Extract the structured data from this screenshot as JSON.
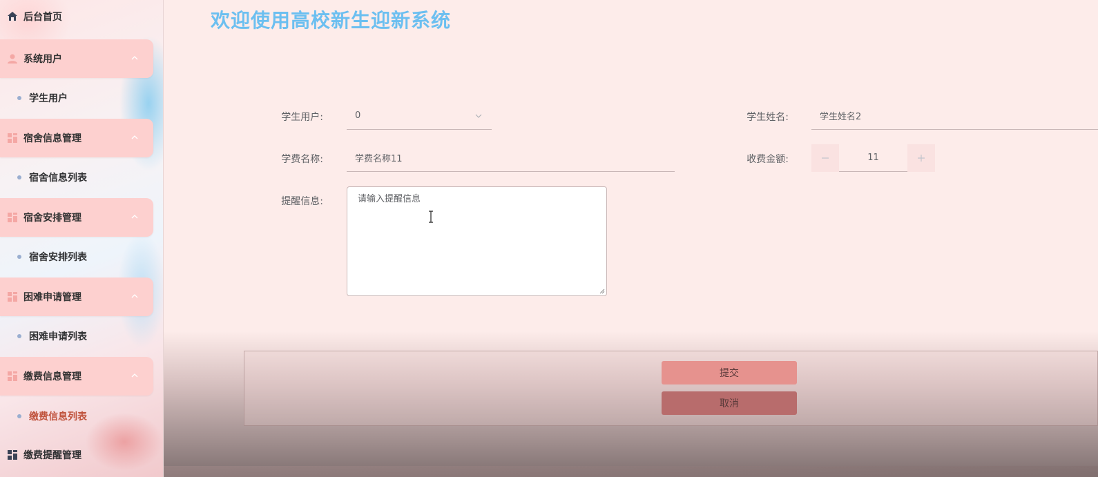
{
  "sidebar": {
    "home": "后台首页",
    "groups": [
      {
        "label": "系统用户",
        "sub": "学生用户"
      },
      {
        "label": "宿舍信息管理",
        "sub": "宿舍信息列表"
      },
      {
        "label": "宿舍安排管理",
        "sub": "宿舍安排列表"
      },
      {
        "label": "困难申请管理",
        "sub": "困难申请列表"
      },
      {
        "label": "缴费信息管理",
        "sub": "缴费信息列表"
      }
    ],
    "last": "缴费提醒管理"
  },
  "header": {
    "title": "欢迎使用高校新生迎新系统"
  },
  "form": {
    "student_user_label": "学生用户:",
    "student_user_value": "0",
    "student_name_label": "学生姓名:",
    "student_name_value": "学生姓名2",
    "fee_name_label": "学费名称:",
    "fee_name_value": "学费名称11",
    "amount_label": "收费金额:",
    "amount_value": "11",
    "reminder_label": "提醒信息:",
    "reminder_placeholder": "请输入提醒信息"
  },
  "actions": {
    "submit": "提交",
    "cancel": "取消"
  },
  "colors": {
    "title": "#6cbff0",
    "accent": "#c0533d",
    "menu_bg": "#fdd0cf"
  }
}
